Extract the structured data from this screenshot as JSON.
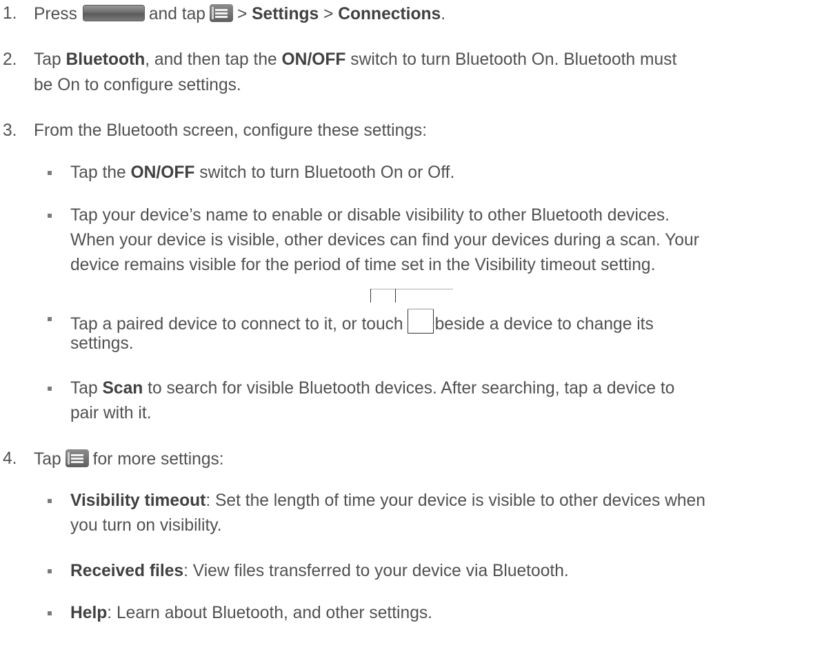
{
  "steps": [
    {
      "number": "1.",
      "press": "Press",
      "and_tap": "and tap",
      "sep1": ">",
      "settings": "Settings",
      "sep2": ">",
      "connections": "Connections",
      "end": "."
    },
    {
      "number": "2.",
      "tap": "Tap",
      "bluetooth": "Bluetooth",
      "then": ", and then tap the",
      "onoff": "ON/OFF",
      "rest1": "switch to turn Bluetooth On. Bluetooth must",
      "line2": "be On to configure settings."
    },
    {
      "number": "3.",
      "text": "From the Bluetooth screen, configure these settings:",
      "bullets": [
        {
          "tap": "Tap the",
          "onoff": "ON/OFF",
          "rest": "switch to turn Bluetooth On or Off."
        },
        {
          "line1": "Tap your device’s name to enable or disable visibility to other Bluetooth devices.",
          "line2": "When your device is visible, other devices can find your devices during a scan. Your",
          "line3": "device remains visible for the period of time set in the Visibility timeout setting."
        },
        {
          "pre": "Tap a paired device to connect to it, or touch",
          "post": "beside a device to change its",
          "line2": "settings."
        },
        {
          "tap": "Tap",
          "scan": "Scan",
          "rest": "to search for visible Bluetooth devices. After searching, tap a device to",
          "line2": "pair with it."
        }
      ]
    },
    {
      "number": "4.",
      "tap": "Tap",
      "rest": "for more settings:",
      "bullets": [
        {
          "term": "Visibility timeout",
          "desc": ": Set the length of time your device is visible to other devices when",
          "line2": "you turn on visibility."
        },
        {
          "term": "Received files",
          "desc": ": View files transferred to your device via Bluetooth."
        },
        {
          "term": "Help",
          "desc": ": Learn about Bluetooth, and other settings."
        }
      ]
    }
  ],
  "icons": {
    "home_key": "home-key-icon",
    "menu_key": "menu-key-icon",
    "settings_icon": "settings-icon"
  }
}
